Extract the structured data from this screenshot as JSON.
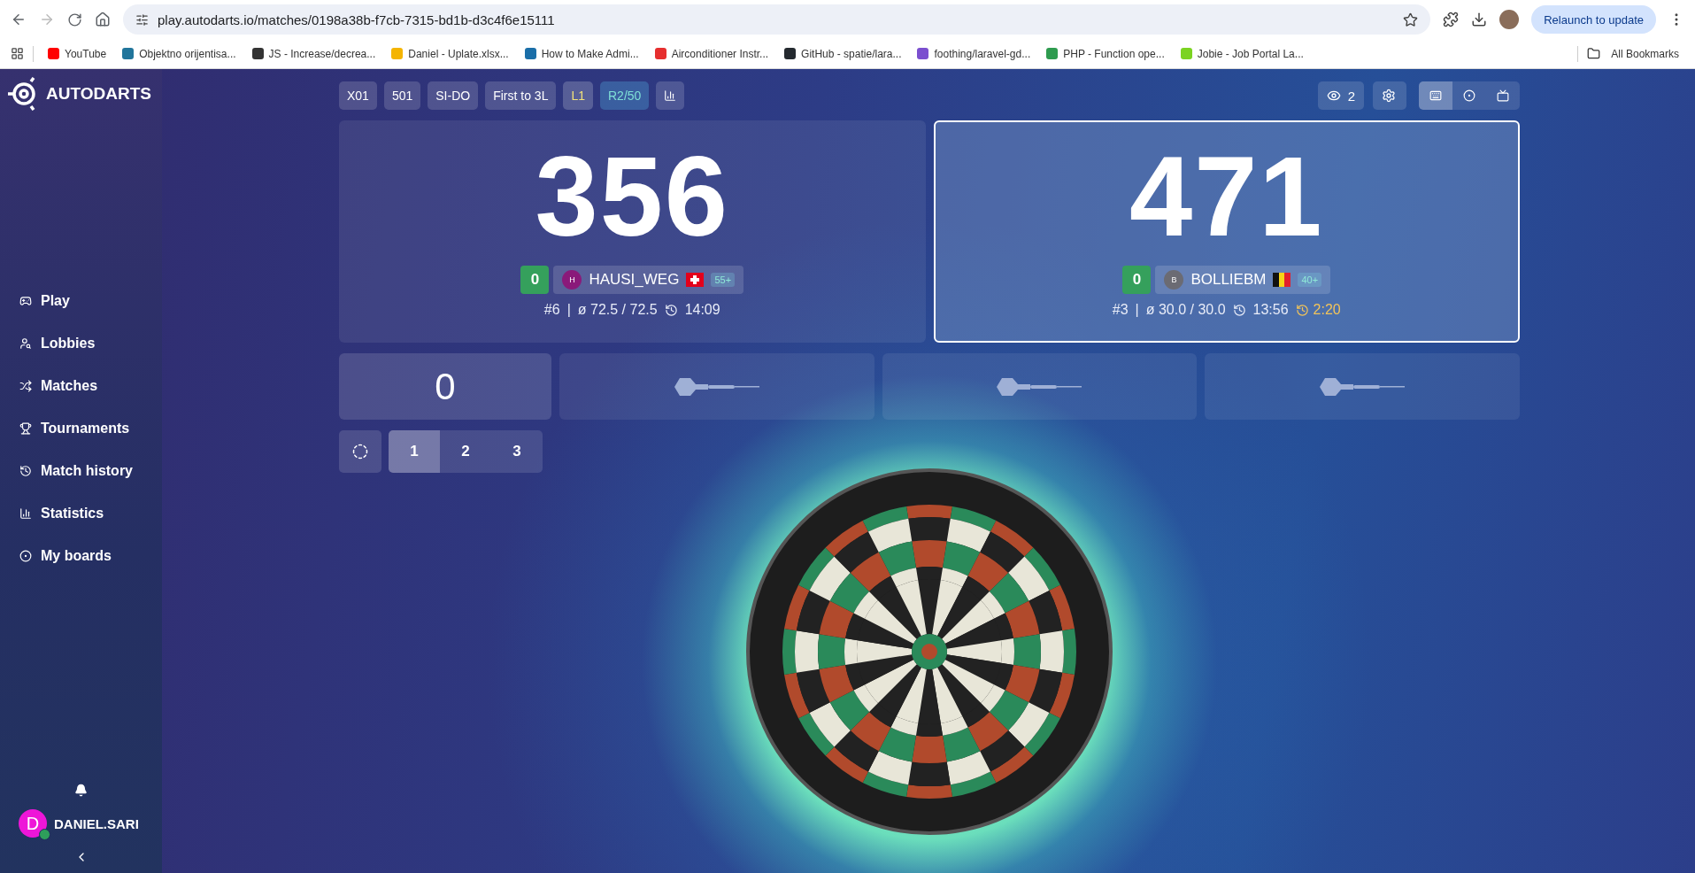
{
  "browser": {
    "url": "play.autodarts.io/matches/0198a38b-f7cb-7315-bd1b-d3c4f6e15111",
    "relaunch": "Relaunch to update",
    "all_bookmarks": "All Bookmarks",
    "bookmarks": [
      {
        "label": "YouTube",
        "color": "#ff0000"
      },
      {
        "label": "Objektno orijentisa...",
        "color": "#21759b"
      },
      {
        "label": "JS - Increase/decrea...",
        "color": "#333333"
      },
      {
        "label": "Daniel - Uplate.xlsx...",
        "color": "#f4b400"
      },
      {
        "label": "How to Make Admi...",
        "color": "#1a6ea8"
      },
      {
        "label": "Airconditioner Instr...",
        "color": "#e62e2e"
      },
      {
        "label": "GitHub - spatie/lara...",
        "color": "#24292f"
      },
      {
        "label": "foothing/laravel-gd...",
        "color": "#7b4fcf"
      },
      {
        "label": "PHP - Function ope...",
        "color": "#2e9b4f"
      },
      {
        "label": "Jobie - Job Portal La...",
        "color": "#7bd321"
      }
    ]
  },
  "sidebar": {
    "logo": "AUTODARTS",
    "items": [
      {
        "label": "Play",
        "kind": "play"
      },
      {
        "label": "Lobbies",
        "kind": "lobbies"
      },
      {
        "label": "Matches",
        "kind": "matches"
      },
      {
        "label": "Tournaments",
        "kind": "tournaments"
      },
      {
        "label": "Match history",
        "kind": "history"
      },
      {
        "label": "Statistics",
        "kind": "stats"
      },
      {
        "label": "My boards",
        "kind": "boards"
      }
    ],
    "user": {
      "name": "DANIEL.SARI",
      "initial": "D",
      "online": true
    }
  },
  "chips": [
    {
      "label": "X01",
      "kind": "plain"
    },
    {
      "label": "501",
      "kind": "plain"
    },
    {
      "label": "SI-DO",
      "kind": "plain"
    },
    {
      "label": "First to 3L",
      "kind": "plain"
    },
    {
      "label": "L1",
      "kind": "leg"
    },
    {
      "label": "R2/50",
      "kind": "round"
    },
    {
      "kind": "stats"
    }
  ],
  "viewers": "2",
  "view_modes": [
    {
      "kind": "keyboard",
      "selected": true
    },
    {
      "kind": "board",
      "selected": false
    },
    {
      "kind": "video",
      "selected": false
    }
  ],
  "players": [
    {
      "score": "356",
      "legs": "0",
      "initial": "H",
      "color": "#8a1a7a",
      "name": "HAUSI_WEG",
      "flag": {
        "kind": "ch"
      },
      "badge": "55+",
      "rank": "#6",
      "separator": "|",
      "average": "ø 72.5 / 72.5",
      "time": "14:09",
      "active": false
    },
    {
      "score": "471",
      "legs": "0",
      "initial": "B",
      "color": "#6b6b73",
      "name": "BOLLIEBM",
      "flag": {
        "kind": "be"
      },
      "badge": "40+",
      "rank": "#3",
      "separator": "|",
      "average": "ø 30.0 / 30.0",
      "time": "13:56",
      "turn_timer": "2:20",
      "active": true
    }
  ],
  "turn": {
    "points": "0",
    "throws": [
      {
        "kind": "empty"
      },
      {
        "kind": "empty"
      },
      {
        "kind": "empty"
      }
    ]
  },
  "multipliers": [
    {
      "label": "1",
      "selected": true
    },
    {
      "label": "2",
      "selected": false
    },
    {
      "label": "3",
      "selected": false
    }
  ]
}
